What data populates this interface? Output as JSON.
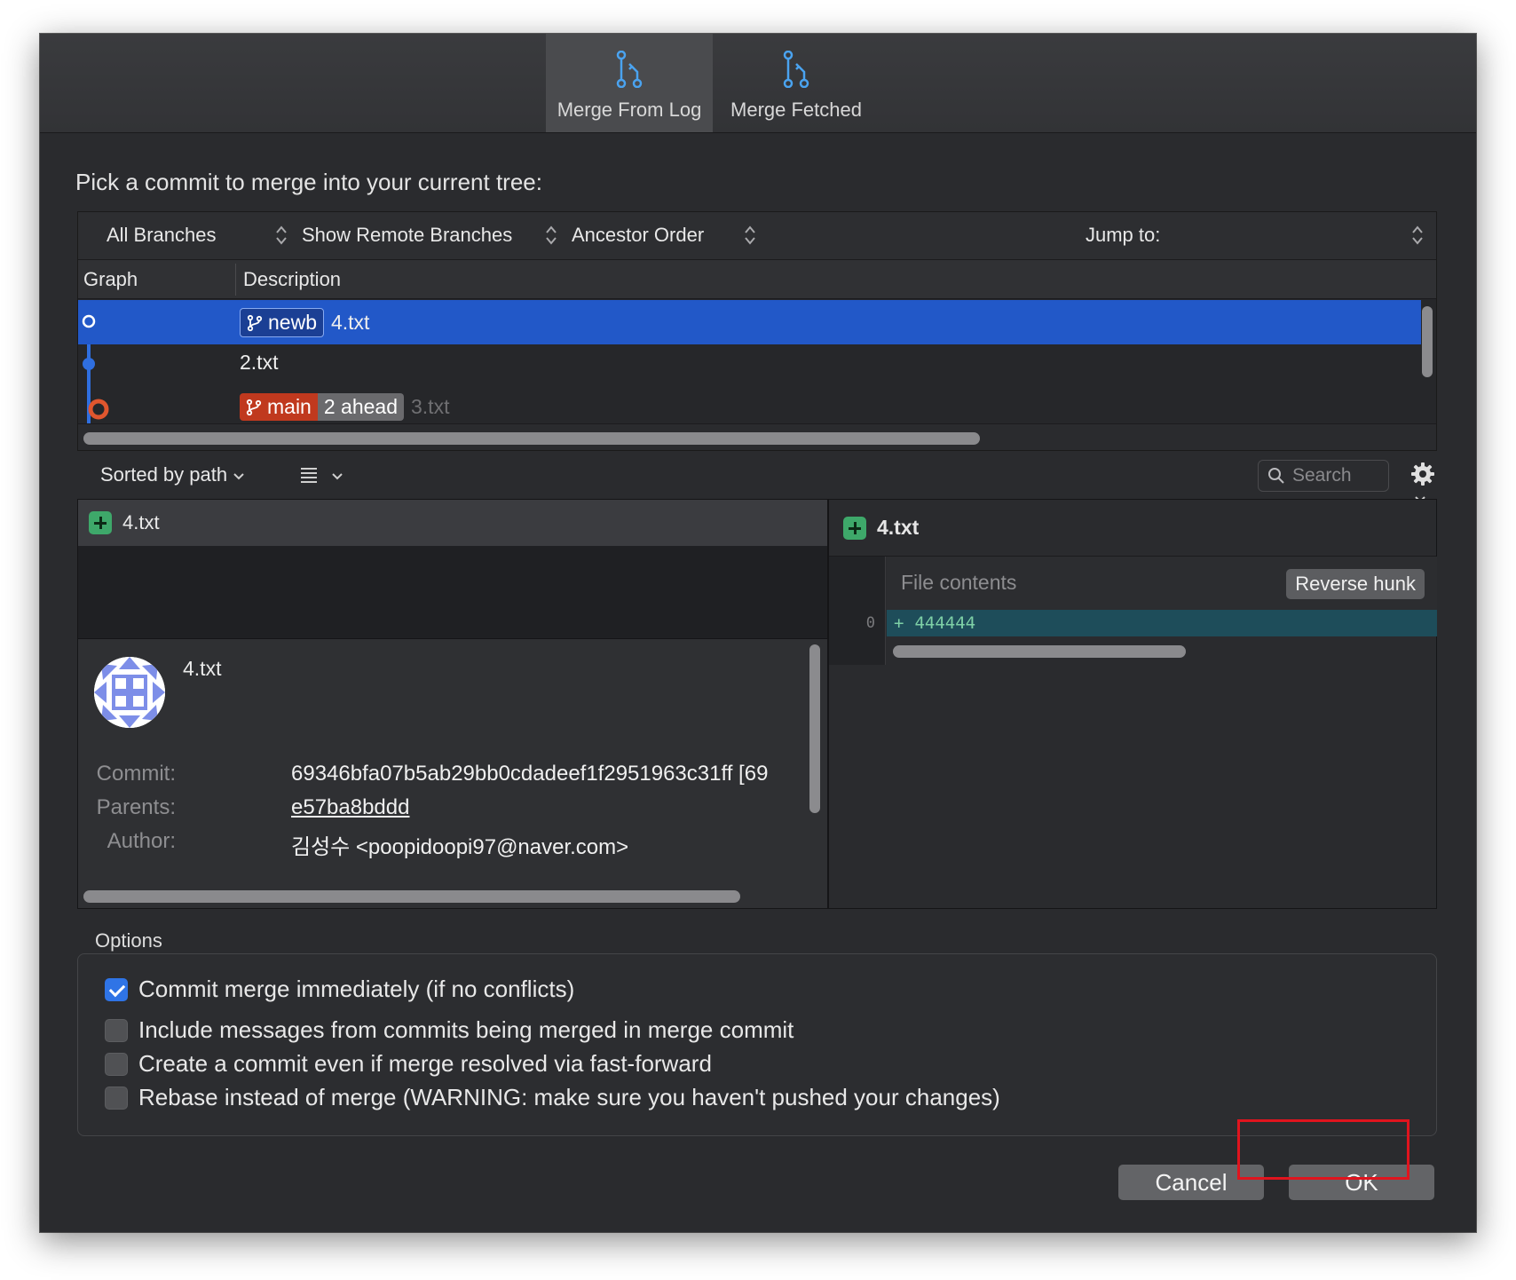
{
  "tabs": [
    {
      "label": "Merge From Log",
      "active": true
    },
    {
      "label": "Merge Fetched",
      "active": false
    }
  ],
  "prompt": "Pick a commit to merge into your current tree:",
  "log_toolbar": {
    "branches": "All Branches",
    "remote": "Show Remote Branches",
    "order": "Ancestor Order",
    "jump": "Jump to:"
  },
  "log_columns": {
    "graph": "Graph",
    "description": "Description"
  },
  "commits": [
    {
      "branch": "newb",
      "message": "4.txt",
      "selected": true
    },
    {
      "message": "2.txt"
    },
    {
      "branch": "main",
      "ahead": "2 ahead",
      "message": "3.txt"
    }
  ],
  "file_toolbar": {
    "sort": "Sorted by path",
    "search_placeholder": "Search"
  },
  "file_list": [
    {
      "name": "4.txt",
      "status": "added"
    }
  ],
  "details": {
    "title": "4.txt",
    "commit_label": "Commit:",
    "commit_value": "69346bfa07b5ab29bb0cdadeef1f2951963c31ff [69",
    "parents_label": "Parents:",
    "parents_value": "e57ba8bddd",
    "author_label": "Author:",
    "author_value": "김성수 <poopidoopi97@naver.com>"
  },
  "diff": {
    "file": "4.txt",
    "section": "File contents",
    "reverse_button": "Reverse hunk",
    "line_number": "0",
    "line_prefix": "+",
    "line_text": "444444"
  },
  "options": {
    "title": "Options",
    "items": [
      {
        "label": "Commit merge immediately (if no conflicts)",
        "checked": true
      },
      {
        "label": "Include messages from commits being merged in merge commit",
        "checked": false
      },
      {
        "label": "Create a commit even if merge resolved via fast-forward",
        "checked": false
      },
      {
        "label": "Rebase instead of merge (WARNING: make sure you haven't pushed your changes)",
        "checked": false
      }
    ]
  },
  "buttons": {
    "cancel": "Cancel",
    "ok": "OK"
  },
  "colors": {
    "selection": "#2258c8",
    "main_branch": "#c0391e",
    "accent": "#2f74e6",
    "highlight_box": "#e0141e"
  }
}
